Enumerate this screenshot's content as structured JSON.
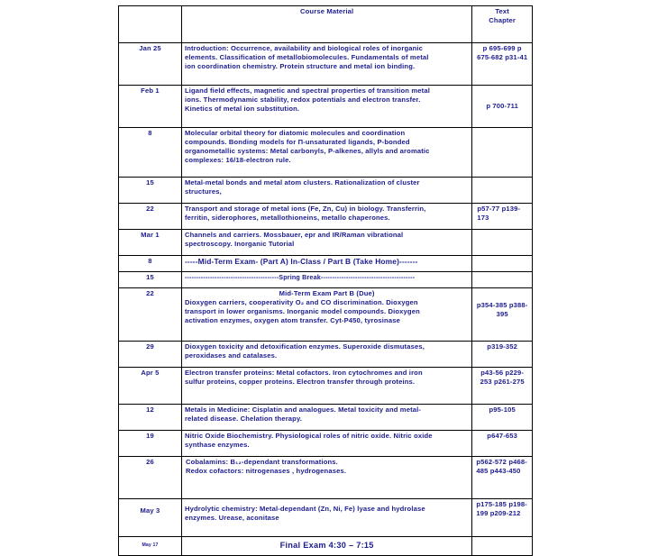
{
  "header": {
    "date_col": "",
    "course_material": "Course Material",
    "text_chapter_line1": "Text",
    "text_chapter_line2": "Chapter"
  },
  "rows": [
    {
      "date": "Jan 25",
      "material": [
        "Introduction: Occurrence, availability and biological roles of inorganic",
        "elements. Classification of metallobiomolecules. Fundamentals of metal",
        "ion coordination chemistry.  Protein structure and metal ion binding."
      ],
      "chapter": [
        "p 695-699",
        "p 675-682",
        "p31-41"
      ]
    },
    {
      "date": "Feb 1",
      "material": [
        "Ligand field effects, magnetic and spectral properties of transition metal",
        "ions. Thermodynamic stability, redox potentials and electron transfer.",
        "Kinetics of metal ion substitution."
      ],
      "chapter": [
        "p 700-711"
      ]
    },
    {
      "date": "8",
      "material": [
        "Molecular orbital theory for diatomic molecules and coordination",
        "compounds. Bonding models for Π-unsaturated ligands, P-bonded",
        "organometallic systems: Metal carbonyls, P-alkenes, allyls and aromatic",
        "complexes: 16/18-electron rule."
      ],
      "chapter": []
    },
    {
      "date": "15",
      "material": [
        "Metal-metal bonds and metal atom clusters. Rationalization of cluster",
        "structures,"
      ],
      "chapter": []
    },
    {
      "date": "22",
      "material": [
        "Transport and storage of metal ions (Fe, Zn, Cu) in biology.  Transferrin,",
        "ferritin, siderophores, metallothioneins, metallo chaperones."
      ],
      "chapter": [
        "p57-77",
        "p139-173"
      ]
    },
    {
      "date": "Mar 1",
      "material": [
        "Channels and carriers. Mossbauer, epr and IR/Raman vibrational",
        "spectroscopy.   Inorganic Tutorial"
      ],
      "chapter": []
    },
    {
      "date": "8",
      "material": [
        "-----Mid-Term Exam- (Part A) In-Class / Part B (Take Home)-------"
      ],
      "chapter": []
    },
    {
      "date": "15",
      "material": [
        "-----------------------------------------Spring Break-----------------------------------------"
      ],
      "chapter": []
    },
    {
      "date": "22",
      "material_title": "Mid-Term Exam Part B (Due)",
      "material": [
        "Dioxygen carriers, cooperativity  O₂ and CO discrimination. Dioxygen",
        "transport in lower organisms. Inorganic  model compounds. Dioxygen",
        "activation enzymes, oxygen atom transfer. Cyt-P450, tyrosinase"
      ],
      "chapter": [
        "p354-385",
        "p388-395"
      ]
    },
    {
      "date": "29",
      "material": [
        "Dioxygen toxicity and detoxification enzymes. Superoxide dismutases,",
        "peroxidases and catalases."
      ],
      "chapter": [
        "p319-352"
      ]
    },
    {
      "date": "Apr 5",
      "material": [
        "Electron transfer proteins: Metal cofactors. Iron cytochromes and iron",
        "sulfur proteins, copper proteins. Electron transfer through proteins."
      ],
      "chapter": [
        "p43-56",
        "p229-253",
        "p261-275"
      ]
    },
    {
      "date": "12",
      "material": [
        "Metals in Medicine: Cisplatin and analogues. Metal toxicity and metal-",
        "related disease. Chelation therapy."
      ],
      "chapter": [
        "p95-105"
      ]
    },
    {
      "date": "19",
      "material": [
        "Nitric Oxide Biochemistry. Physiological roles of nitric oxide. Nitric oxide",
        "synthase enzymes."
      ],
      "chapter": [
        "p647-653"
      ]
    },
    {
      "date": "26",
      "material_serif": [
        "Cobalamins: B₁₂-dependant transformations.",
        " Redox cofactors: nitrogenases , hydrogenases."
      ],
      "material": [],
      "chapter": [
        "p562-572",
        "p468-485",
        "p443-450"
      ]
    },
    {
      "date": "May 3",
      "material": [
        "Hydrolytic chemistry: Metal-dependant (Zn, Ni, Fe) lyase and hydrolase",
        "enzymes. Urease, aconitase"
      ],
      "chapter": [
        "p175-185",
        "p198-199",
        "p209-212"
      ]
    },
    {
      "date": "May 17",
      "material_center": "Final Exam  4:30 – 7:15",
      "material": [],
      "chapter": []
    }
  ]
}
